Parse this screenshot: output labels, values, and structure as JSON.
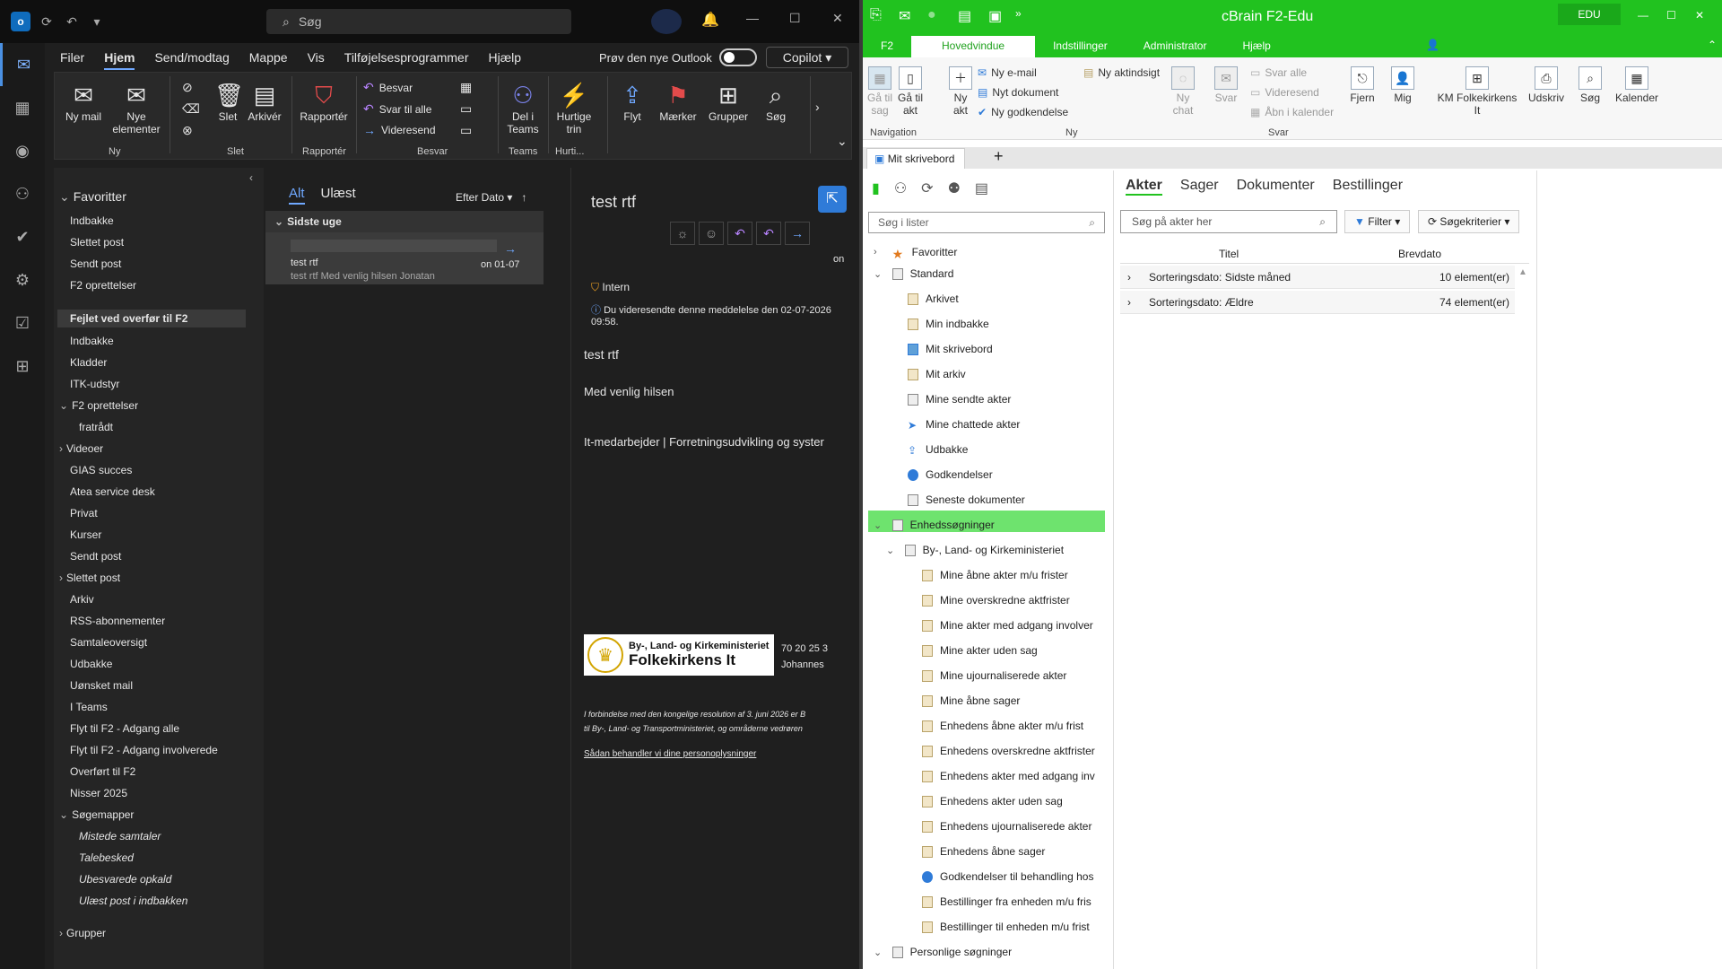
{
  "outlook": {
    "search_placeholder": "Søg",
    "menu": [
      "Filer",
      "Hjem",
      "Send/modtag",
      "Mappe",
      "Vis",
      "Tilføjelsesprogrammer",
      "Hjælp"
    ],
    "try_new": "Prøv den nye Outlook",
    "copilot": "Copilot",
    "ribbon": {
      "ny_mail": "Ny mail",
      "nye_elementer": "Nye elementer",
      "group_ny": "Ny",
      "slet": "Slet",
      "arkiver": "Arkivér",
      "group_slet": "Slet",
      "rapporter": "Rapportér",
      "group_rapporter": "Rapportér",
      "besvar": "Besvar",
      "svar_til_alle": "Svar til alle",
      "videresend": "Videresend",
      "group_besvar": "Besvar",
      "del_i_teams": "Del i Teams",
      "group_teams": "Teams",
      "hurtige_trin": "Hurtige trin",
      "group_hurti": "Hurti...",
      "flyt": "Flyt",
      "maerker": "Mærker",
      "grupper": "Grupper",
      "soeg": "Søg"
    },
    "folders": [
      "Favoritter",
      "Indbakke",
      "Slettet post",
      "Sendt post",
      "F2 oprettelser",
      "Fejlet ved overfør til F2",
      "Indbakke",
      "Kladder",
      "ITK-udstyr",
      "F2 oprettelser",
      "fratrådt",
      "Videoer",
      "GIAS succes",
      "Atea service desk",
      "Privat",
      "Kurser",
      "Sendt post",
      "Slettet post",
      "Arkiv",
      "RSS-abonnementer",
      "Samtaleoversigt",
      "Udbakke",
      "Uønsket mail",
      "I Teams",
      "Flyt til F2 - Adgang alle",
      "Flyt til F2 - Adgang involverede",
      "Overført til F2",
      "Nisser 2025",
      "Søgemapper",
      "Mistede samtaler",
      "Talebesked",
      "Ubesvarede opkald",
      "Ulæst post i indbakken",
      "Grupper"
    ],
    "list": {
      "tab_all": "Alt",
      "tab_unread": "Ulæst",
      "sort": "Efter Dato",
      "group": "Sidste uge",
      "msg_subject": "test rtf",
      "msg_date": "on 01-07",
      "msg_preview": "test rtf  Med venlig hilsen  Jonatan"
    },
    "reading": {
      "title": "test rtf",
      "label": "Intern",
      "fwd_info": "Du videresendte denne meddelelse den 02-07-2026 09:58.",
      "body1": "test rtf",
      "body2": "Med venlig hilsen",
      "body3": "It-medarbejder | Forretningsudvikling og syster",
      "logo1": "By-, Land- og Kirkeministeriet",
      "logo2": "Folkekirkens It",
      "phone": "70 20 25 3",
      "name": "Johannes",
      "disclaimer1": "I forbindelse med den kongelige resolution af 3. juni 2026 er B",
      "disclaimer2": "til By-, Land- og Transportministeriet, og områderne vedrøren",
      "link": "Sådan behandler vi dine personoplysninger",
      "on": "on"
    }
  },
  "f2": {
    "title": "cBrain F2-Edu",
    "edu": "EDU",
    "tabs": [
      "F2",
      "Hovedvindue",
      "Indstillinger",
      "Administrator",
      "Hjælp"
    ],
    "ribbon": {
      "ga_til_sag": "Gå til sag",
      "ga_til_akt": "Gå til akt",
      "ny_akt": "Ny akt",
      "group_nav": "Navigation",
      "ny_email": "Ny e-mail",
      "nyt_dokument": "Nyt dokument",
      "ny_godkendelse": "Ny godkendelse",
      "ny_aktindsigt": "Ny aktindsigt",
      "ny_chat": "Ny chat",
      "group_ny": "Ny",
      "svar": "Svar",
      "svar_alle": "Svar alle",
      "videresend": "Videresend",
      "aabn_i_kalender": "Åbn i kalender",
      "group_svar": "Svar",
      "fjern": "Fjern",
      "mig": "Mig",
      "km": "KM Folkekirkens It",
      "udskriv": "Udskriv",
      "soeg": "Søg",
      "kalender": "Kalender"
    },
    "doc_tab": "Mit skrivebord",
    "search_lists": "Søg i lister",
    "tree": [
      "Favoritter",
      "Standard",
      "Arkivet",
      "Min indbakke",
      "Mit skrivebord",
      "Mit arkiv",
      "Mine sendte akter",
      "Mine chattede akter",
      "Udbakke",
      "Godkendelser",
      "Seneste dokumenter",
      "Enhedssøgninger",
      "By-, Land- og Kirkeministeriet",
      "Mine åbne akter m/u frister",
      "Mine overskredne aktfrister",
      "Mine akter med adgang involver",
      "Mine akter uden sag",
      "Mine ujournaliserede akter",
      "Mine åbne sager",
      "Enhedens åbne akter m/u frist",
      "Enhedens overskredne aktfrister",
      "Enhedens akter med adgang inv",
      "Enhedens akter uden sag",
      "Enhedens ujournaliserede akter",
      "Enhedens åbne sager",
      "Godkendelser til behandling hos",
      "Bestillinger fra enheden m/u fris",
      "Bestillinger til enheden m/u frist",
      "Personlige søgninger"
    ],
    "right_tabs": [
      "Akter",
      "Sager",
      "Dokumenter",
      "Bestillinger"
    ],
    "search_acts": "Søg på akter her",
    "filter": "Filter",
    "criteria": "Søgekriterier",
    "col_title": "Titel",
    "col_date": "Brevdato",
    "rows": [
      {
        "label": "Sorteringsdato:  Sidste måned",
        "count": "10 element(er)"
      },
      {
        "label": "Sorteringsdato:  Ældre",
        "count": "74 element(er)"
      }
    ]
  }
}
